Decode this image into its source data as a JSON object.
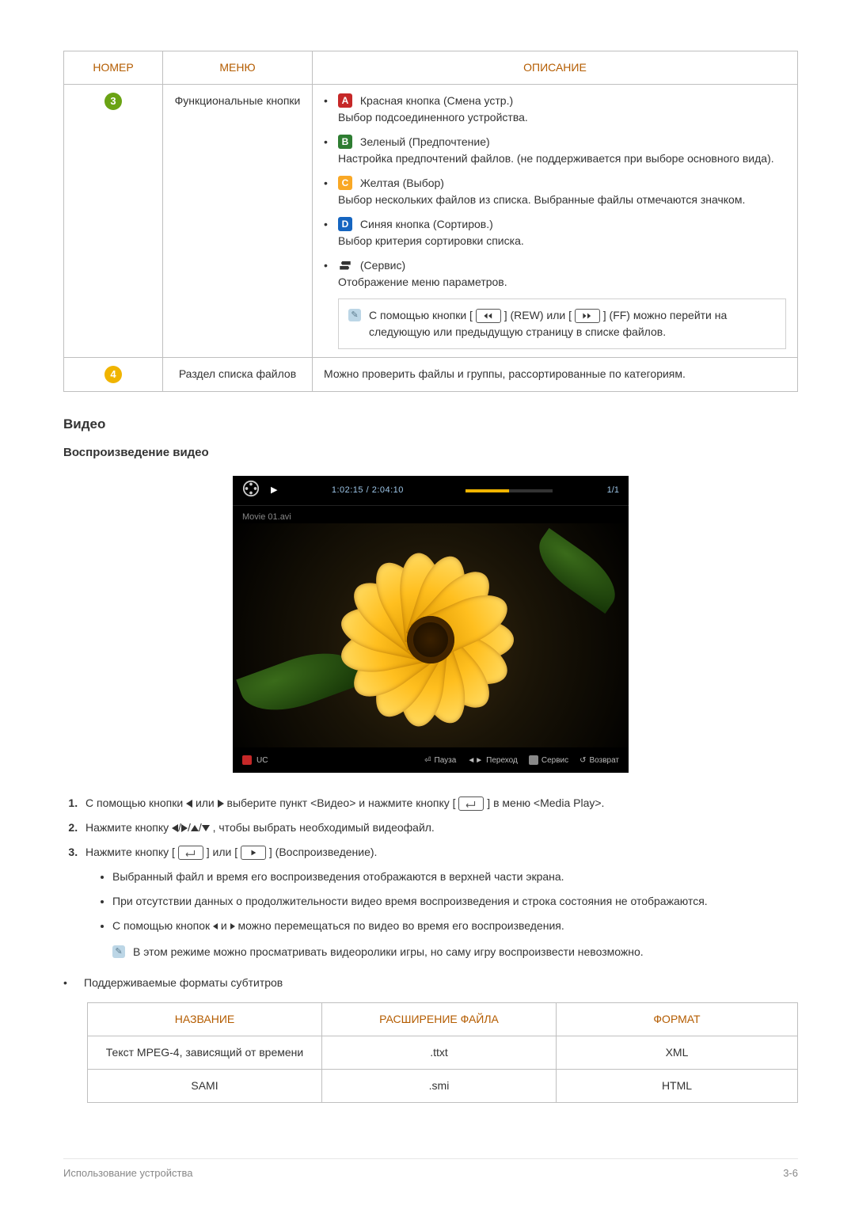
{
  "table1": {
    "headers": {
      "num": "НОМЕР",
      "menu": "МЕНЮ",
      "desc": "ОПИСАНИЕ"
    },
    "row3": {
      "num": "3",
      "menu": "Функциональные кнопки",
      "red": {
        "label": "Красная кнопка (Смена устр.)",
        "text": "Выбор подсоединенного устройства."
      },
      "green": {
        "label": "Зеленый (Предпочтение)",
        "text": "Настройка предпочтений файлов. (не поддерживается при выборе основного вида)."
      },
      "yellow": {
        "label": "Желтая (Выбор)",
        "text": "Выбор нескольких файлов из списка. Выбранные файлы отмечаются значком."
      },
      "blue": {
        "label": "Синяя кнопка (Сортиров.)",
        "text": "Выбор критерия сортировки списка."
      },
      "tools": {
        "label": "(Сервис)",
        "text": "Отображение меню параметров."
      },
      "note": {
        "t1": "С помощью кнопки [",
        "rew": "] (REW) или [",
        "ff": "] (FF) можно перейти на следующую или предыдущую страницу в списке файлов."
      }
    },
    "row4": {
      "num": "4",
      "menu": "Раздел списка файлов",
      "desc": "Можно проверить файлы и группы, рассортированные по категориям."
    }
  },
  "section": {
    "video": "Видео",
    "playback": "Воспроизведение видео"
  },
  "player": {
    "time": "1:02:15 / 2:04:10",
    "page": "1/1",
    "filename": "Movie 01.avi",
    "bottom": {
      "left_label": "UC",
      "pause": "Пауза",
      "nav": "Переход",
      "tools": "Сервис",
      "return": "Возврат"
    }
  },
  "steps": {
    "s1a": "С помощью кнопки ",
    "s1b": " или ",
    "s1c": " выберите пункт <Видео> и нажмите кнопку [",
    "s1d": "] в меню <Media Play>.",
    "s2a": "Нажмите кнопку ",
    "s2b": ", чтобы выбрать необходимый видеофайл.",
    "s3a": "Нажмите кнопку [",
    "s3b": "] или [",
    "s3c": "] (Воспроизведение).",
    "sub1": "Выбранный файл и время его воспроизведения отображаются в верхней части экрана.",
    "sub2": "При отсутствии данных о продолжительности видео время воспроизведения и строка состояния не отображаются.",
    "sub3a": "С помощью кнопок ",
    "sub3b": " и ",
    "sub3c": " можно перемещаться по видео во время его воспроизведения.",
    "note": "В этом режиме можно просматривать видеоролики игры, но саму игру воспроизвести невозможно."
  },
  "subtitle_section": "Поддерживаемые форматы субтитров",
  "table2": {
    "headers": {
      "name": "НАЗВАНИЕ",
      "ext": "РАСШИРЕНИЕ ФАЙЛА",
      "fmt": "ФОРМАТ"
    },
    "rows": [
      {
        "name": "Текст MPEG-4, зависящий от времени",
        "ext": ".ttxt",
        "fmt": "XML"
      },
      {
        "name": "SAMI",
        "ext": ".smi",
        "fmt": "HTML"
      }
    ]
  },
  "footer": {
    "left": "Использование устройства",
    "right": "3-6"
  }
}
